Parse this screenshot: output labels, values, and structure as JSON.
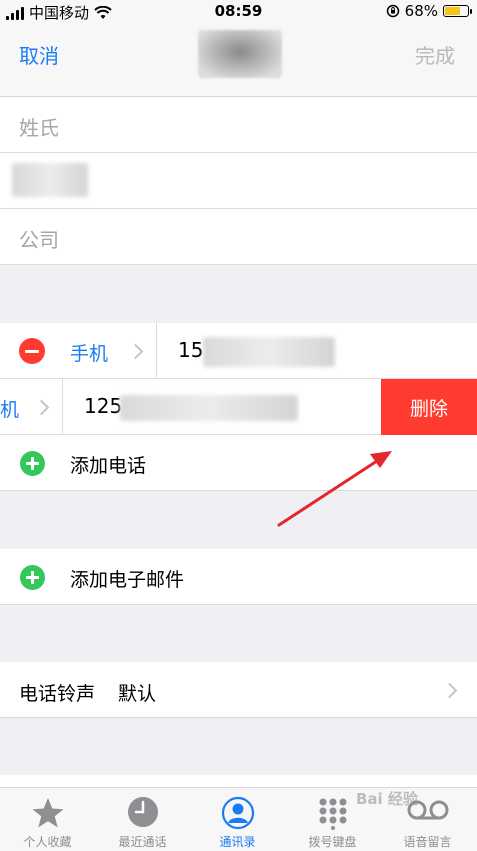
{
  "status": {
    "carrier": "中国移动",
    "time": "08:59",
    "battery": "68%",
    "battery_level": 0.68
  },
  "nav": {
    "cancel": "取消",
    "done": "完成"
  },
  "name": {
    "last_name_placeholder": "姓氏",
    "company_placeholder": "公司"
  },
  "phones": [
    {
      "label": "手机",
      "number_prefix": "15"
    },
    {
      "label": "机",
      "number_prefix": "125",
      "delete": "删除"
    }
  ],
  "actions": {
    "add_phone": "添加电话",
    "add_email": "添加电子邮件"
  },
  "ringtone": {
    "label": "电话铃声",
    "value": "默认"
  },
  "tabs": [
    {
      "label": "个人收藏",
      "icon": "star-icon",
      "active": false
    },
    {
      "label": "最近通话",
      "icon": "clock-icon",
      "active": false
    },
    {
      "label": "通讯录",
      "icon": "person-circle-icon",
      "active": true
    },
    {
      "label": "拨号键盘",
      "icon": "keypad-icon",
      "active": false
    },
    {
      "label": "语音留言",
      "icon": "voicemail-icon",
      "active": false
    }
  ],
  "colors": {
    "accent": "#1a7cf5",
    "destructive": "#ff3b30",
    "add": "#34c759",
    "annotation_arrow": "#e5262b"
  },
  "watermark": "Bai 经验"
}
